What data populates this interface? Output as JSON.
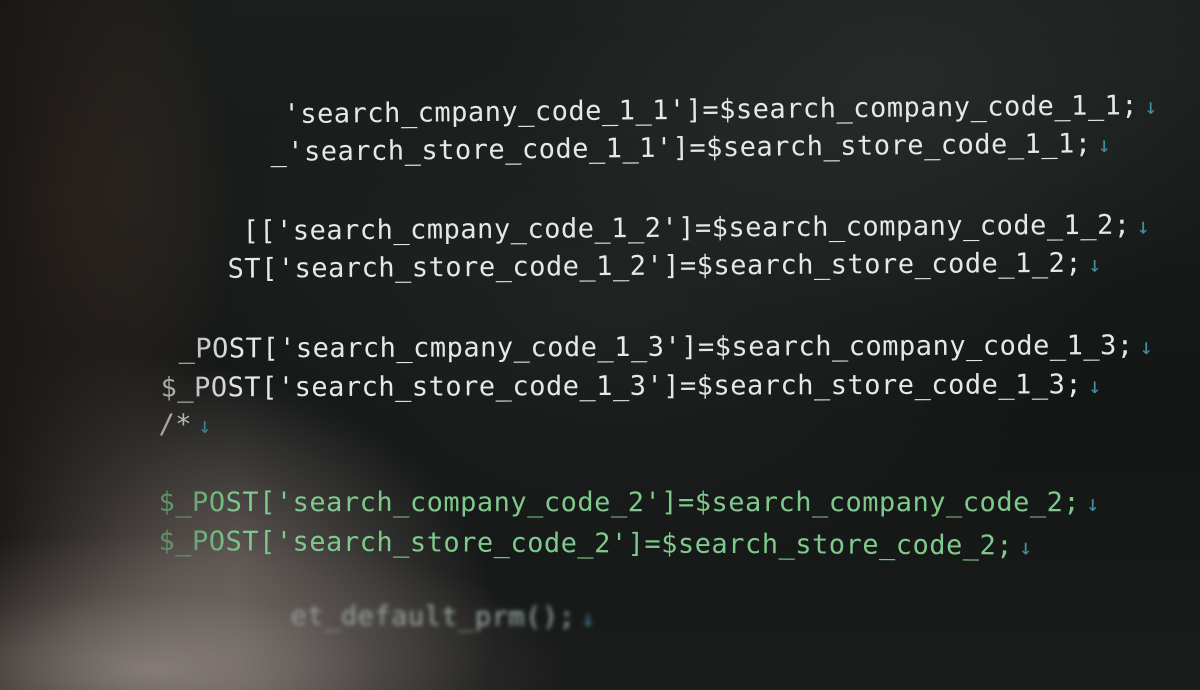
{
  "code_lines": [
    {
      "text": "'search_cmpany_code_1_1']=$search_company_code_1_1;",
      "arrow": "↓"
    },
    {
      "text": "_'search_store_code_1_1']=$search_store_code_1_1;",
      "arrow": "↓"
    },
    {
      "text": "[['search_cmpany_code_1_2']=$search_company_code_1_2;",
      "arrow": "↓"
    },
    {
      "text": "ST['search_store_code_1_2']=$search_store_code_1_2;",
      "arrow": "↓"
    },
    {
      "text": "_POST['search_cmpany_code_1_3']=$search_company_code_1_3;",
      "arrow": "↓"
    },
    {
      "text": "$_POST['search_store_code_1_3']=$search_store_code_1_3;",
      "arrow": "↓"
    },
    {
      "text": "/*",
      "arrow": "↓"
    },
    {
      "text": "$_POST['search_company_code_2']=$search_company_code_2;",
      "arrow": "↓"
    },
    {
      "text": "$_POST['search_store_code_2']=$search_store_code_2;",
      "arrow": "↓"
    },
    {
      "text": "et_default_prm();",
      "arrow": "↓"
    }
  ],
  "colors": {
    "background": "#141716",
    "code_white": "#e4e8e6",
    "code_green": "#7ec98c",
    "newline_arrow": "#3f8fa0"
  }
}
